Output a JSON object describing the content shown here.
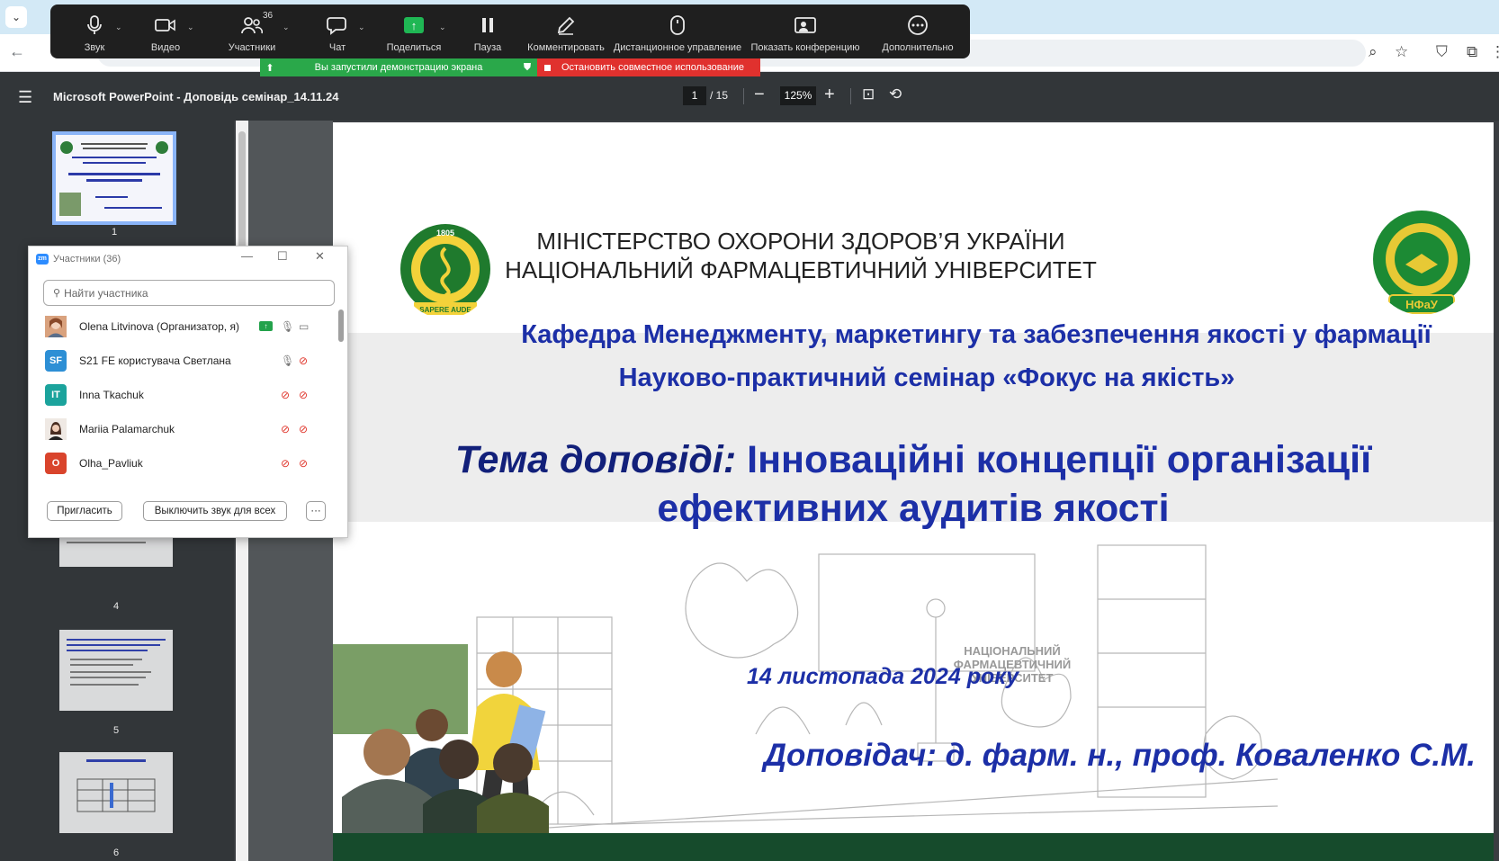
{
  "zoom_toolbar": {
    "items": [
      {
        "label": "Звук",
        "icon": "microphone-icon"
      },
      {
        "label": "Видео",
        "icon": "video-camera-icon"
      },
      {
        "label": "Участники",
        "icon": "participants-icon",
        "count": "36"
      },
      {
        "label": "Чат",
        "icon": "chat-icon"
      },
      {
        "label": "Поделиться",
        "icon": "share-screen-icon"
      },
      {
        "label": "Пауза",
        "icon": "pause-icon"
      },
      {
        "label": "Комментировать",
        "icon": "annotate-pen-icon"
      },
      {
        "label": "Дистанционное управление",
        "icon": "remote-control-mouse-icon"
      },
      {
        "label": "Показать конференцию",
        "icon": "show-meeting-icon"
      },
      {
        "label": "Дополнительно",
        "icon": "more-icon"
      }
    ],
    "share_status": "Вы запустили демонстрацию экрана",
    "stop_share": "Остановить совместное использование"
  },
  "pdf_toolbar": {
    "title": "Microsoft PowerPoint - Доповідь семінар_14.11.24",
    "page_current": "1",
    "page_total": "/ 15",
    "zoom": "125%"
  },
  "thumbnails": [
    {
      "num": "1",
      "active": true
    },
    {
      "num": "4",
      "active": false
    },
    {
      "num": "5",
      "active": false
    },
    {
      "num": "6",
      "active": false
    }
  ],
  "participants_panel": {
    "title": "Участники (36)",
    "search_placeholder": "Найти участника",
    "participants": [
      {
        "name": "Olena Litvinova (Организатор, я)",
        "initials": "",
        "avatar_color": "#b06040",
        "mic": "on",
        "cam": "on",
        "sharing": true
      },
      {
        "name": "S21 FE користувача Светлана",
        "initials": "SF",
        "avatar_color": "#2d8fd5",
        "mic": "on",
        "cam": "off",
        "sharing": false
      },
      {
        "name": "Inna Tkachuk",
        "initials": "IT",
        "avatar_color": "#1ba39c",
        "mic": "off",
        "cam": "off",
        "sharing": false
      },
      {
        "name": "Mariia Palamarchuk",
        "initials": "",
        "avatar_color": "#6b4f45",
        "mic": "off",
        "cam": "off",
        "sharing": false
      },
      {
        "name": "Olha_Pavliuk",
        "initials": "O",
        "avatar_color": "#d9442c",
        "mic": "off",
        "cam": "off",
        "sharing": false
      }
    ],
    "invite_label": "Пригласить",
    "mute_all_label": "Выключить звук для всех",
    "more_label": "···"
  },
  "slide": {
    "ministry_line1": "МІНІСТЕРСТВО ОХОРОНИ ЗДОРОВ’Я УКРАЇНИ",
    "ministry_line2": "НАЦІОНАЛЬНИЙ ФАРМАЦЕВТИЧНИЙ УНІВЕРСИТЕТ",
    "department": "Кафедра Менеджменту, маркетингу та забезпечення якості у фармації",
    "seminar": "Науково-практичний семінар «Фокус на якість»",
    "topic_label": "Тема доповіді:",
    "topic_text": " Інноваційні концепції організації ефективних аудитів якості",
    "date": "14 листопада 2024 року",
    "speaker": "Доповідач: д. фарм. н., проф. Коваленко С.М.",
    "sketch_sign_line1": "НАЦІОНАЛЬНИЙ",
    "sketch_sign_line2": "ФАРМАЦЕВТИЧНИЙ",
    "sketch_sign_line3": "УНІВЕРСИТЕТ",
    "left_emblem_year": "1805",
    "left_emblem_motto": "SAPERE AUDE",
    "right_emblem_text": "НФаУ"
  }
}
